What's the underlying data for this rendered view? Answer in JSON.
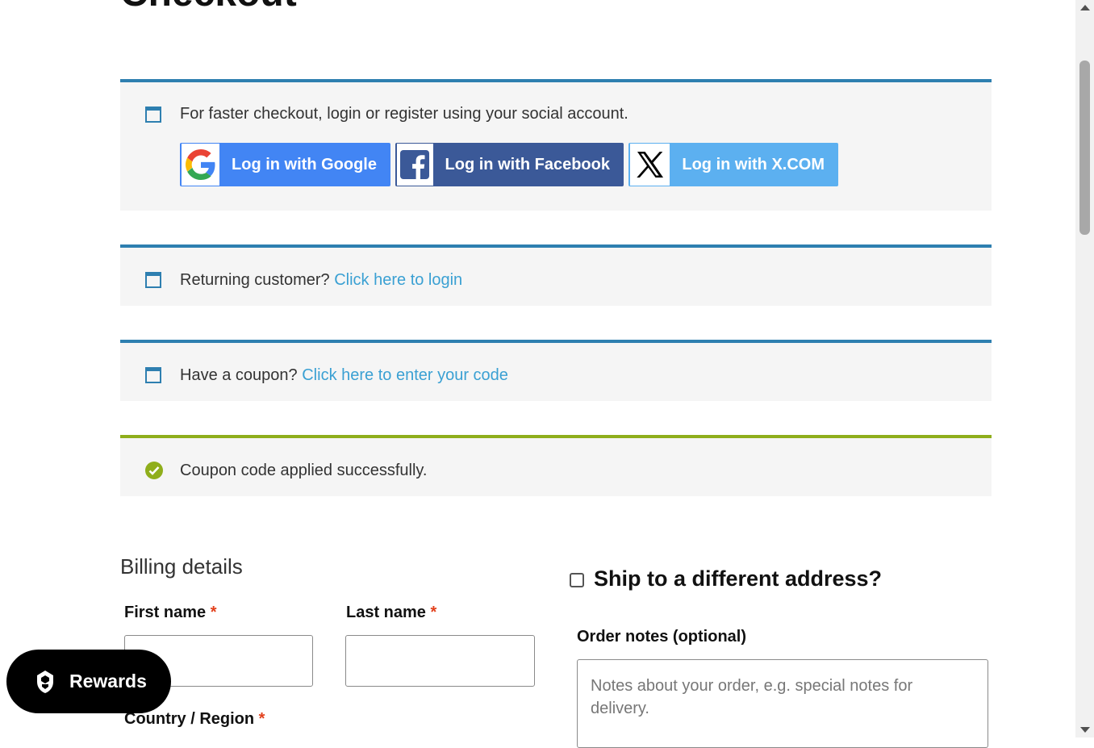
{
  "page": {
    "title": "Checkout"
  },
  "notices": {
    "social": {
      "message": "For faster checkout, login or register using your social account.",
      "buttons": [
        {
          "label": "Log in with Google",
          "icon": "google-icon",
          "color": "#4285f4"
        },
        {
          "label": "Log in with Facebook",
          "icon": "facebook-icon",
          "color": "#3b5998"
        },
        {
          "label": "Log in with X.COM",
          "icon": "x-icon",
          "color": "#5cb0f0"
        }
      ]
    },
    "login": {
      "text": "Returning customer?",
      "link": "Click here to login"
    },
    "coupon": {
      "text": "Have a coupon?",
      "link": "Click here to enter your code"
    },
    "success": {
      "text": "Coupon code applied successfully."
    }
  },
  "billing": {
    "title": "Billing details",
    "first_name_label": "First name",
    "last_name_label": "Last name",
    "country_label": "Country / Region",
    "required_mark": "*"
  },
  "shipping": {
    "ship_label": "Ship to a different address?",
    "ship_checked": false,
    "notes_label": "Order notes (optional)",
    "notes_placeholder": "Notes about your order, e.g. special notes for delivery."
  },
  "rewards": {
    "label": "Rewards"
  },
  "colors": {
    "info_accent": "#2e7fb0",
    "success_accent": "#8fae1b",
    "link": "#3aa0d3",
    "required": "#e2401c"
  }
}
